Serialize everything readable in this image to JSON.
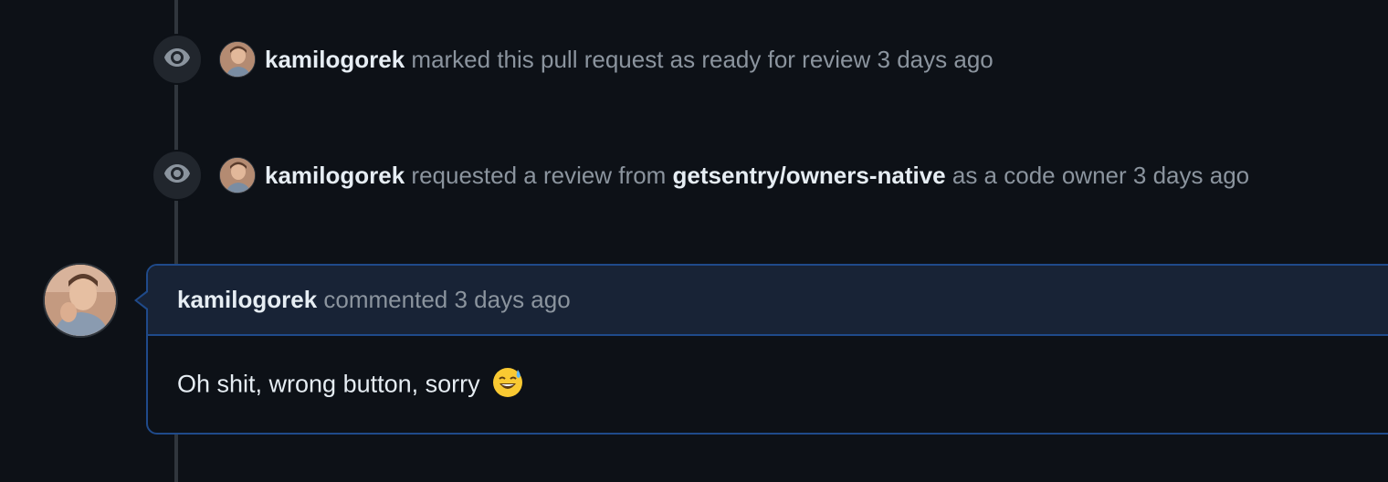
{
  "timeline": {
    "events": [
      {
        "icon": "eye-icon",
        "actor": "kamilogorek",
        "action": "marked this pull request as ready for review",
        "time": "3 days ago"
      },
      {
        "icon": "eye-icon",
        "actor": "kamilogorek",
        "action": "requested a review from",
        "target": "getsentry/owners-native",
        "suffix": "as a code owner",
        "time": "3 days ago"
      }
    ],
    "comment": {
      "author": "kamilogorek",
      "action": "commented",
      "time": "3 days ago",
      "body": "Oh shit, wrong button, sorry",
      "emoji": "sweat-smile-emoji"
    }
  },
  "colors": {
    "background": "#0d1117",
    "comment_border": "#1f4a8a",
    "comment_header_bg": "#182336",
    "muted_text": "#8b949e",
    "strong_text": "#e6edf3"
  }
}
